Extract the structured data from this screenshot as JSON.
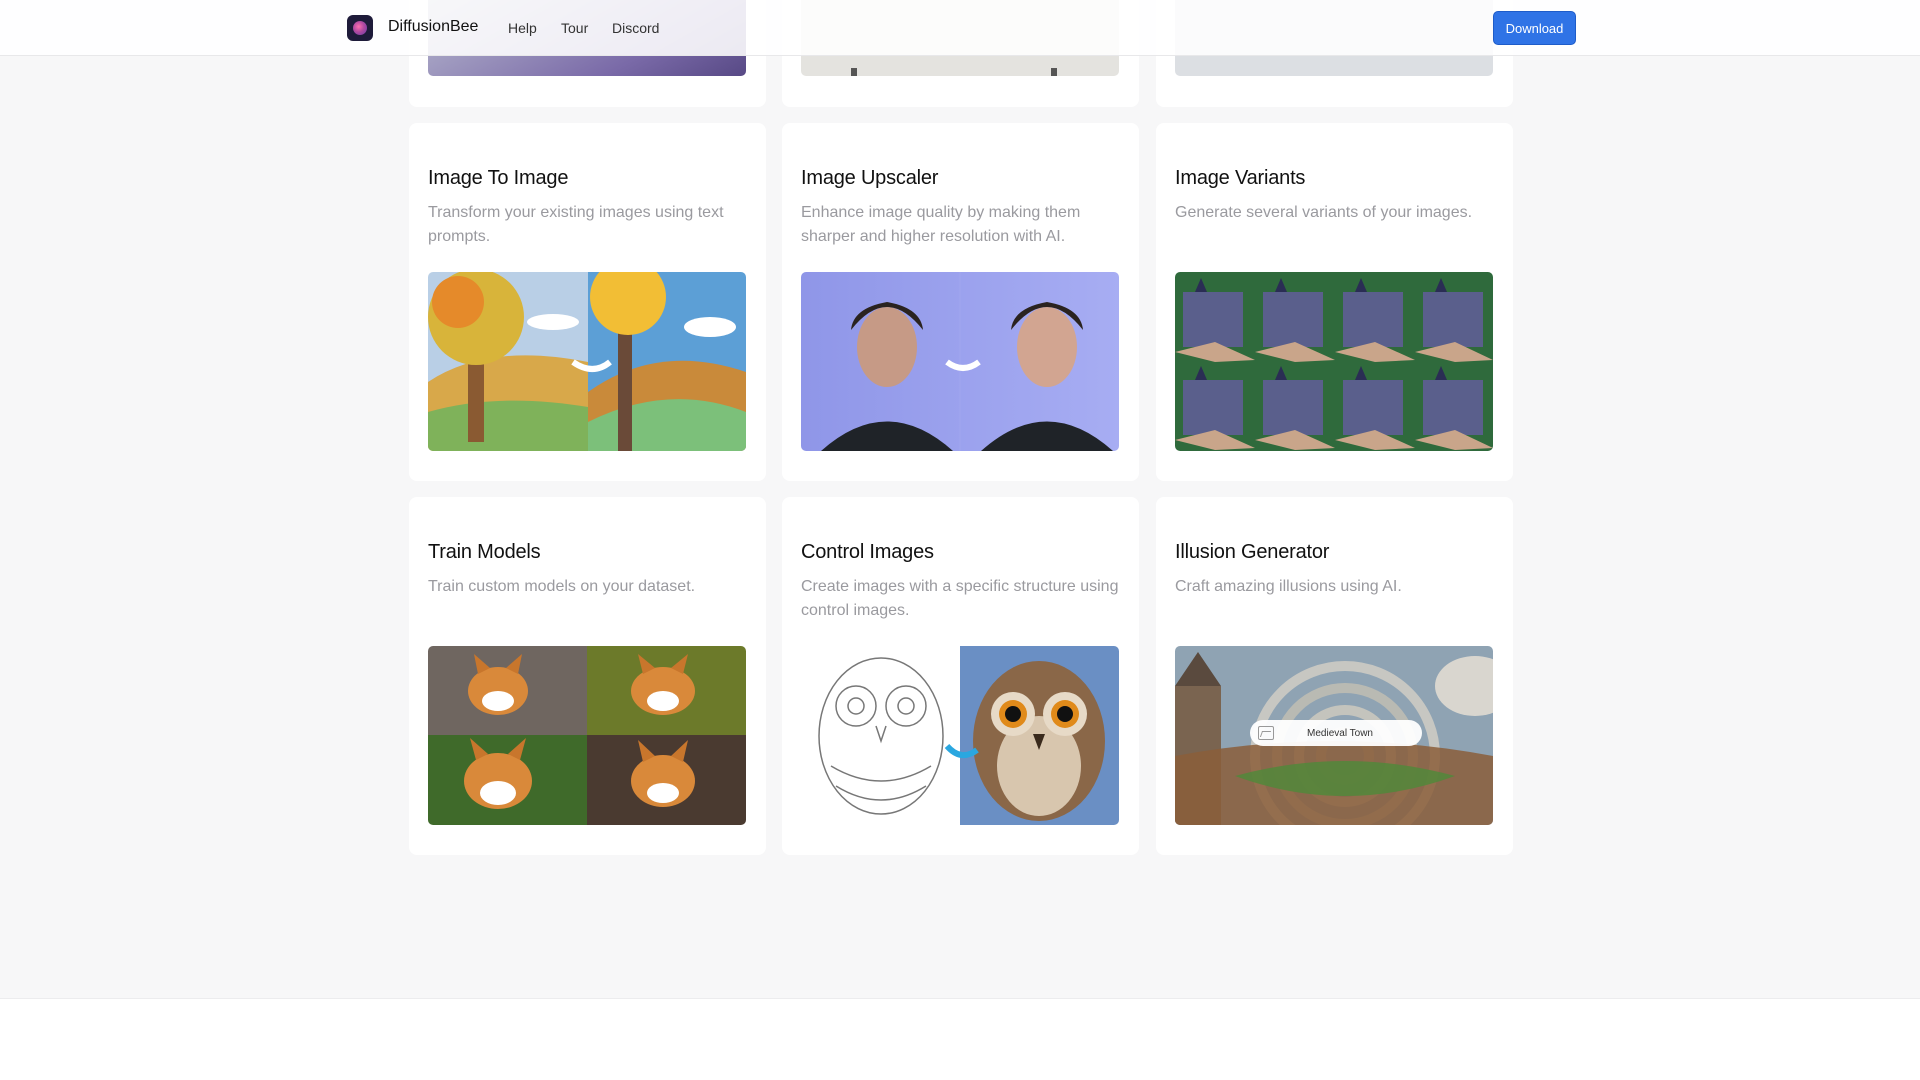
{
  "nav": {
    "brand": "DiffusionBee",
    "links": [
      "Help",
      "Tour",
      "Discord"
    ],
    "download": "Download"
  },
  "features": [
    {
      "title": "Image To Image",
      "desc": "Transform your existing images using text prompts."
    },
    {
      "title": "Image Upscaler",
      "desc": "Enhance image quality by making them sharper and higher resolution with AI."
    },
    {
      "title": "Image Variants",
      "desc": "Generate several variants of your images."
    },
    {
      "title": "Train Models",
      "desc": "Train custom models on your dataset."
    },
    {
      "title": "Control Images",
      "desc": "Create images with a specific structure using control images."
    },
    {
      "title": "Illusion Generator",
      "desc": "Craft amazing illusions using AI."
    }
  ],
  "illusion_prompt": "Medieval Town",
  "icons": {
    "logo": "diffusionbee-logo-icon",
    "prompt_image": "image-icon"
  },
  "colors": {
    "accent": "#2f73e6",
    "page_background": "#f7f7f8",
    "card_background": "#ffffff",
    "description_text": "#9a9a9f"
  }
}
